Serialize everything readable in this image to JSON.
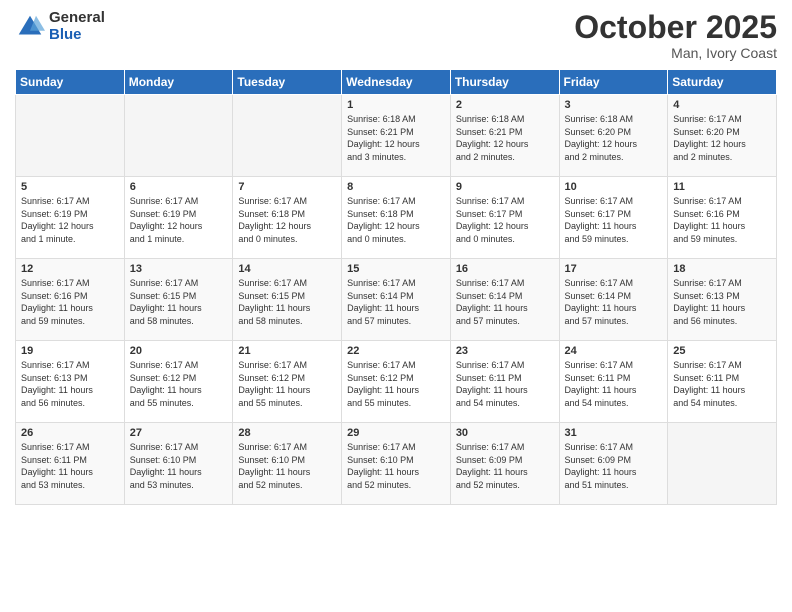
{
  "logo": {
    "general": "General",
    "blue": "Blue"
  },
  "title": "October 2025",
  "location": "Man, Ivory Coast",
  "days_header": [
    "Sunday",
    "Monday",
    "Tuesday",
    "Wednesday",
    "Thursday",
    "Friday",
    "Saturday"
  ],
  "weeks": [
    [
      {
        "day": "",
        "info": ""
      },
      {
        "day": "",
        "info": ""
      },
      {
        "day": "",
        "info": ""
      },
      {
        "day": "1",
        "info": "Sunrise: 6:18 AM\nSunset: 6:21 PM\nDaylight: 12 hours\nand 3 minutes."
      },
      {
        "day": "2",
        "info": "Sunrise: 6:18 AM\nSunset: 6:21 PM\nDaylight: 12 hours\nand 2 minutes."
      },
      {
        "day": "3",
        "info": "Sunrise: 6:18 AM\nSunset: 6:20 PM\nDaylight: 12 hours\nand 2 minutes."
      },
      {
        "day": "4",
        "info": "Sunrise: 6:17 AM\nSunset: 6:20 PM\nDaylight: 12 hours\nand 2 minutes."
      }
    ],
    [
      {
        "day": "5",
        "info": "Sunrise: 6:17 AM\nSunset: 6:19 PM\nDaylight: 12 hours\nand 1 minute."
      },
      {
        "day": "6",
        "info": "Sunrise: 6:17 AM\nSunset: 6:19 PM\nDaylight: 12 hours\nand 1 minute."
      },
      {
        "day": "7",
        "info": "Sunrise: 6:17 AM\nSunset: 6:18 PM\nDaylight: 12 hours\nand 0 minutes."
      },
      {
        "day": "8",
        "info": "Sunrise: 6:17 AM\nSunset: 6:18 PM\nDaylight: 12 hours\nand 0 minutes."
      },
      {
        "day": "9",
        "info": "Sunrise: 6:17 AM\nSunset: 6:17 PM\nDaylight: 12 hours\nand 0 minutes."
      },
      {
        "day": "10",
        "info": "Sunrise: 6:17 AM\nSunset: 6:17 PM\nDaylight: 11 hours\nand 59 minutes."
      },
      {
        "day": "11",
        "info": "Sunrise: 6:17 AM\nSunset: 6:16 PM\nDaylight: 11 hours\nand 59 minutes."
      }
    ],
    [
      {
        "day": "12",
        "info": "Sunrise: 6:17 AM\nSunset: 6:16 PM\nDaylight: 11 hours\nand 59 minutes."
      },
      {
        "day": "13",
        "info": "Sunrise: 6:17 AM\nSunset: 6:15 PM\nDaylight: 11 hours\nand 58 minutes."
      },
      {
        "day": "14",
        "info": "Sunrise: 6:17 AM\nSunset: 6:15 PM\nDaylight: 11 hours\nand 58 minutes."
      },
      {
        "day": "15",
        "info": "Sunrise: 6:17 AM\nSunset: 6:14 PM\nDaylight: 11 hours\nand 57 minutes."
      },
      {
        "day": "16",
        "info": "Sunrise: 6:17 AM\nSunset: 6:14 PM\nDaylight: 11 hours\nand 57 minutes."
      },
      {
        "day": "17",
        "info": "Sunrise: 6:17 AM\nSunset: 6:14 PM\nDaylight: 11 hours\nand 57 minutes."
      },
      {
        "day": "18",
        "info": "Sunrise: 6:17 AM\nSunset: 6:13 PM\nDaylight: 11 hours\nand 56 minutes."
      }
    ],
    [
      {
        "day": "19",
        "info": "Sunrise: 6:17 AM\nSunset: 6:13 PM\nDaylight: 11 hours\nand 56 minutes."
      },
      {
        "day": "20",
        "info": "Sunrise: 6:17 AM\nSunset: 6:12 PM\nDaylight: 11 hours\nand 55 minutes."
      },
      {
        "day": "21",
        "info": "Sunrise: 6:17 AM\nSunset: 6:12 PM\nDaylight: 11 hours\nand 55 minutes."
      },
      {
        "day": "22",
        "info": "Sunrise: 6:17 AM\nSunset: 6:12 PM\nDaylight: 11 hours\nand 55 minutes."
      },
      {
        "day": "23",
        "info": "Sunrise: 6:17 AM\nSunset: 6:11 PM\nDaylight: 11 hours\nand 54 minutes."
      },
      {
        "day": "24",
        "info": "Sunrise: 6:17 AM\nSunset: 6:11 PM\nDaylight: 11 hours\nand 54 minutes."
      },
      {
        "day": "25",
        "info": "Sunrise: 6:17 AM\nSunset: 6:11 PM\nDaylight: 11 hours\nand 54 minutes."
      }
    ],
    [
      {
        "day": "26",
        "info": "Sunrise: 6:17 AM\nSunset: 6:11 PM\nDaylight: 11 hours\nand 53 minutes."
      },
      {
        "day": "27",
        "info": "Sunrise: 6:17 AM\nSunset: 6:10 PM\nDaylight: 11 hours\nand 53 minutes."
      },
      {
        "day": "28",
        "info": "Sunrise: 6:17 AM\nSunset: 6:10 PM\nDaylight: 11 hours\nand 52 minutes."
      },
      {
        "day": "29",
        "info": "Sunrise: 6:17 AM\nSunset: 6:10 PM\nDaylight: 11 hours\nand 52 minutes."
      },
      {
        "day": "30",
        "info": "Sunrise: 6:17 AM\nSunset: 6:09 PM\nDaylight: 11 hours\nand 52 minutes."
      },
      {
        "day": "31",
        "info": "Sunrise: 6:17 AM\nSunset: 6:09 PM\nDaylight: 11 hours\nand 51 minutes."
      },
      {
        "day": "",
        "info": ""
      }
    ]
  ]
}
